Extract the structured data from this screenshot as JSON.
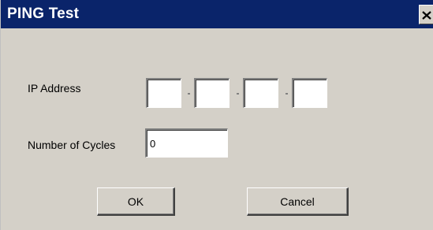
{
  "window": {
    "title": "PING Test",
    "close_glyph": "×"
  },
  "form": {
    "ip_label": "IP Address",
    "ip_octets": [
      "",
      "",
      "",
      ""
    ],
    "ip_separator": ".",
    "cycles_label": "Number of Cycles",
    "cycles_value": "0"
  },
  "buttons": {
    "ok_label": "OK",
    "cancel_label": "Cancel"
  },
  "colors": {
    "titlebar": "#0a246a",
    "dialog_face": "#d4d0c8",
    "field_bg": "#ffffff"
  },
  "icons": {
    "close": "close-icon"
  }
}
